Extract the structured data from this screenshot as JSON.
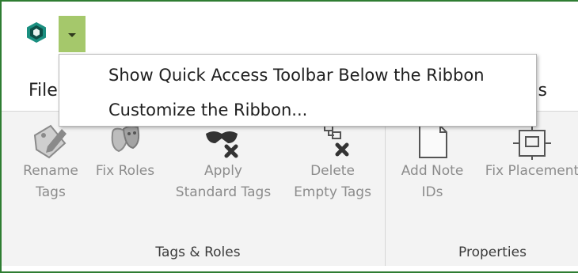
{
  "qat": {
    "logo_icon": "app-logo-icon",
    "dropdown_icon": "chevron-down-icon",
    "accent_color": "#a5c86b"
  },
  "tabs": {
    "file_label": "File",
    "partial_label": "as"
  },
  "menu": {
    "items": [
      {
        "label": "Show Quick Access Toolbar Below the Ribbon"
      },
      {
        "label": "Customize the Ribbon..."
      }
    ]
  },
  "ribbon": {
    "groups": [
      {
        "label": "Tags & Roles",
        "buttons": [
          {
            "line1": "Rename",
            "line2": "Tags",
            "icon": "rename-tags-icon"
          },
          {
            "line1": "Fix Roles",
            "line2": "",
            "icon": "theater-masks-icon"
          },
          {
            "line1": "Apply",
            "line2": "Standard Tags",
            "icon": "apply-standard-tags-icon"
          },
          {
            "line1": "Delete",
            "line2": "Empty Tags",
            "icon": "delete-empty-tags-icon"
          }
        ]
      },
      {
        "label": "Properties",
        "buttons": [
          {
            "line1": "Add Note",
            "line2": "IDs",
            "icon": "add-note-ids-icon"
          },
          {
            "line1": "Fix Placement",
            "line2": "",
            "icon": "fix-placement-icon"
          }
        ]
      }
    ]
  }
}
